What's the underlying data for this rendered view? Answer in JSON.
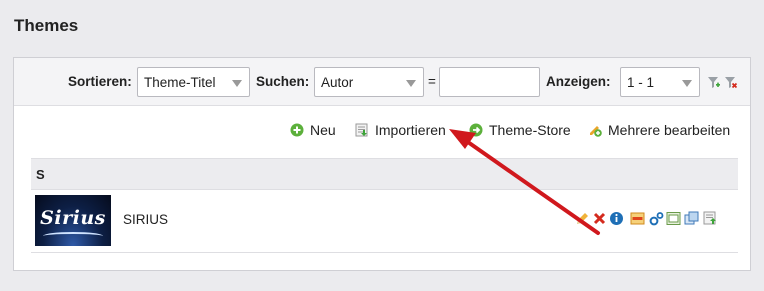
{
  "page": {
    "title": "Themes"
  },
  "filters": {
    "sort_label": "Sortieren:",
    "sort_value": "Theme-Titel",
    "search_label": "Suchen:",
    "search_field_value": "Autor",
    "equals_sign": "=",
    "search_input_value": "",
    "show_label": "Anzeigen:",
    "show_value": "1 - 1",
    "icons": [
      "filter-add-icon",
      "filter-remove-icon"
    ]
  },
  "actions": [
    {
      "label": "Neu",
      "icon": "plus-circle-icon"
    },
    {
      "label": "Importieren",
      "icon": "import-icon"
    },
    {
      "label": "Theme-Store",
      "icon": "store-circle-icon"
    },
    {
      "label": "Mehrere bearbeiten",
      "icon": "multi-edit-icon"
    }
  ],
  "groups": [
    {
      "letter": "S",
      "rows": [
        {
          "thumbnail_text": "Sirius",
          "name": "SIRIUS",
          "row_icons": [
            "edit-icon",
            "delete-icon",
            "info-icon",
            "zip-icon",
            "settings-icon",
            "template-icon",
            "duplicate-icon",
            "export-icon"
          ]
        }
      ]
    }
  ],
  "colors": {
    "annotation_arrow": "#d0181d",
    "green_icon": "#5cb03b",
    "blue_icon": "#1e6fb6",
    "red_icon": "#d42b1e"
  }
}
